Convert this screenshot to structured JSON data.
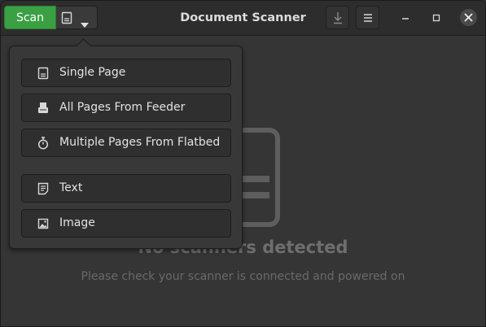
{
  "header": {
    "scan_label": "Scan",
    "title": "Document Scanner",
    "icons": {
      "mode": "document-icon",
      "dropdown": "chevron-down-icon",
      "save": "download-icon",
      "menu": "hamburger-icon",
      "minimize": "minimize-icon",
      "maximize": "maximize-icon",
      "close": "close-icon"
    }
  },
  "empty_state": {
    "icon": "scanner-icon",
    "title": "No scanners detected",
    "subtitle": "Please check your scanner is connected and powered on"
  },
  "menu": {
    "items": [
      {
        "label": "Single Page",
        "icon": "single-page-icon"
      },
      {
        "label": "All Pages From Feeder",
        "icon": "feeder-icon"
      },
      {
        "label": "Multiple Pages From Flatbed",
        "icon": "timer-icon"
      },
      {
        "label": "Text",
        "icon": "text-doc-icon"
      },
      {
        "label": "Image",
        "icon": "image-icon"
      }
    ]
  },
  "colors": {
    "accent": "#3aa043",
    "background": "#353535",
    "headerbar": "#2d2d2d"
  }
}
